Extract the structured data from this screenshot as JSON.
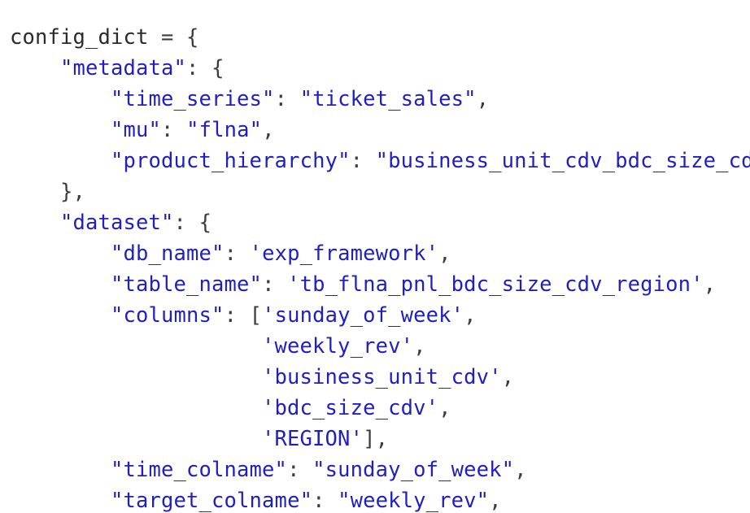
{
  "code": {
    "var": "config_dict",
    "assign": " = ",
    "open_brace": "{",
    "close_brace": "},",
    "comma": ",",
    "colon": ": ",
    "metadata_key": "\"metadata\"",
    "time_series_key": "\"time_series\"",
    "time_series_val": "\"ticket_sales\"",
    "mu_key": "\"mu\"",
    "mu_val": "\"flna\"",
    "product_hierarchy_key": "\"product_hierarchy\"",
    "product_hierarchy_val": "\"business_unit_cdv_bdc_size_cdv_region\"",
    "dataset_key": "\"dataset\"",
    "db_name_key": "\"db_name\"",
    "db_name_val": "'exp_framework'",
    "table_name_key": "\"table_name\"",
    "table_name_val": "'tb_flna_pnl_bdc_size_cdv_region'",
    "columns_key": "\"columns\"",
    "list_open": "[",
    "list_close": "],",
    "col_1": "'sunday_of_week'",
    "col_2": "'weekly_rev'",
    "col_3": "'business_unit_cdv'",
    "col_4": "'bdc_size_cdv'",
    "col_5": "'REGION'",
    "time_colname_key": "\"time_colname\"",
    "time_colname_val": "\"sunday_of_week\"",
    "target_colname_key": "\"target_colname\"",
    "target_colname_val": "\"weekly_rev\""
  }
}
